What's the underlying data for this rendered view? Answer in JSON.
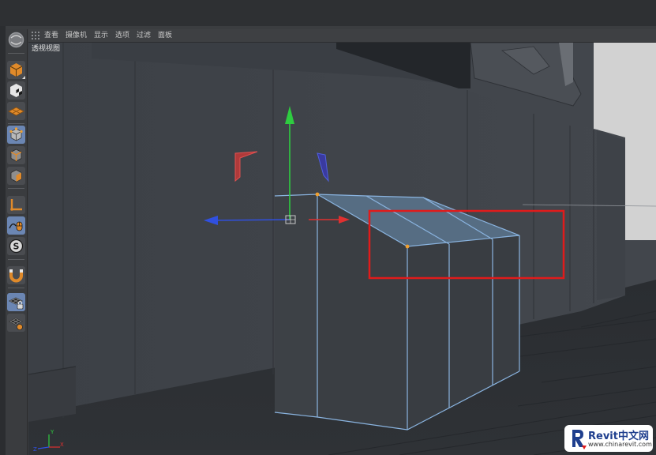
{
  "menu": {
    "items": [
      {
        "label": "查看"
      },
      {
        "label": "摄像机"
      },
      {
        "label": "显示"
      },
      {
        "label": "选项"
      },
      {
        "label": "过滤"
      },
      {
        "label": "面板"
      }
    ]
  },
  "viewport": {
    "label": "透视视图",
    "axis_widget": {
      "x": "X",
      "y": "Y",
      "z": "Z"
    }
  },
  "toolbar": {
    "tools": [
      {
        "icon": "cinema4d-logo-icon",
        "active": false
      },
      {
        "icon": "model-mode-icon",
        "active": false
      },
      {
        "icon": "texture-mode-icon",
        "active": false
      },
      {
        "icon": "workplane-icon",
        "active": false
      },
      {
        "icon": "points-mode-icon",
        "active": true
      },
      {
        "icon": "edges-mode-icon",
        "active": false
      },
      {
        "icon": "polygons-mode-icon",
        "active": false
      },
      {
        "icon": "axis-mode-icon",
        "active": false
      },
      {
        "icon": "tweak-mode-icon",
        "active": true
      },
      {
        "icon": "solo-mode-icon",
        "active": false
      },
      {
        "icon": "snap-magnet-icon",
        "active": false
      },
      {
        "icon": "workplane-lock-icon",
        "active": true
      },
      {
        "icon": "workplane-grid-icon",
        "active": false
      }
    ]
  },
  "annotation": {
    "highlight_color": "#e01b1b"
  },
  "colors": {
    "selection_edge": "#8ab4e0",
    "axis_x": "#e03030",
    "axis_y": "#2ecc40",
    "axis_z": "#3050e0",
    "point": "#f0a030"
  },
  "watermark": {
    "brand": "Revit中文网",
    "url": "www.chinarevit.com"
  }
}
